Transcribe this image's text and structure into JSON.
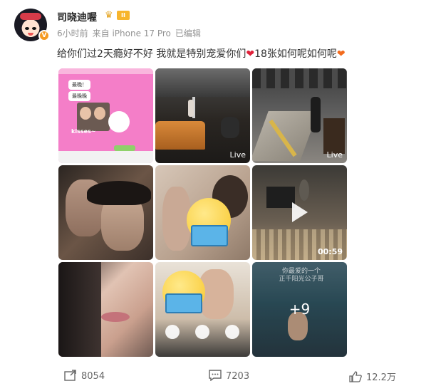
{
  "post": {
    "username": "司晓迪喔",
    "badge_level": "II",
    "verified_badge": "V",
    "time": "6小时前",
    "source": "来自 iPhone 17 Pro",
    "edited": "已编辑",
    "text": "给你们过2天瘾好不好 我就是特别宠爱你们",
    "text_tail": "18张如何呢如何呢"
  },
  "images": {
    "tile1_bubble1": "最晚！",
    "tile1_bubble2": "最晚晚",
    "tile1_kiss": "kisses~",
    "tile2_badge": "Live",
    "tile3_badge": "Live",
    "tile6_duration": "00:59",
    "tile9_caption1": "你最爱的一个",
    "tile9_caption2": "正千阳光公子哥",
    "tile9_more": "+9"
  },
  "actions": {
    "repost_count": "8054",
    "comment_count": "7203",
    "like_count": "12.2万"
  },
  "colors": {
    "accent_gold": "#f7b52c",
    "heart_red": "#e0223a",
    "heart_orange": "#f26b1d",
    "meta_gray": "#939393"
  },
  "icons": [
    "repost-icon",
    "comment-icon",
    "like-icon",
    "play-icon",
    "heart-icon",
    "crown-icon"
  ]
}
